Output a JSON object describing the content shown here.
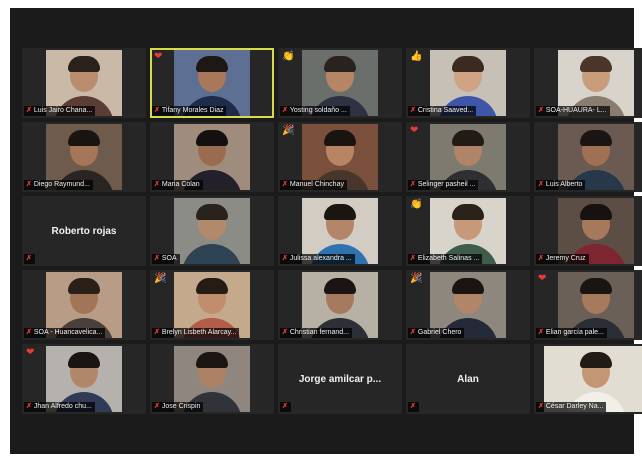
{
  "participants": [
    {
      "name": "Luis Jairo Chana...",
      "reaction": "",
      "active": false,
      "video": true,
      "bg": "#c9b9a6",
      "skin": "#b98c6e",
      "hair": "#2b211c",
      "shirt": "#5b3d35"
    },
    {
      "name": "Tifany Morales Diaz",
      "reaction": "heart",
      "active": true,
      "video": true,
      "bg": "#5d6f93",
      "skin": "#a9775a",
      "hair": "#1e1713",
      "shirt": "#1f2b4b"
    },
    {
      "name": "Yosting soldaño ...",
      "reaction": "clap",
      "active": false,
      "video": true,
      "bg": "#6b6f6b",
      "skin": "#b58566",
      "hair": "#2a231d",
      "shirt": "#2e3140"
    },
    {
      "name": "Cristina Saaved...",
      "reaction": "thumb",
      "active": false,
      "video": true,
      "bg": "#c7c0b6",
      "skin": "#d0a384",
      "hair": "#3a2a20",
      "shirt": "#3d56a8"
    },
    {
      "name": "SOA-HUAURA- L...",
      "reaction": "",
      "active": false,
      "video": true,
      "bg": "#d9d4cb",
      "skin": "#c99c7c",
      "hair": "#4a3528",
      "shirt": "#8a7c6f"
    },
    {
      "name": "Diego Raymund...",
      "reaction": "",
      "active": false,
      "video": true,
      "bg": "#6f5b4c",
      "skin": "#a57657",
      "hair": "#1a1410",
      "shirt": "#2a2523"
    },
    {
      "name": "Maria Colan",
      "reaction": "",
      "active": false,
      "video": true,
      "bg": "#9f8c7c",
      "skin": "#9a6b4e",
      "hair": "#141010",
      "shirt": "#23202a"
    },
    {
      "name": "Manuel Chinchay",
      "reaction": "party",
      "active": false,
      "video": true,
      "bg": "#7a4f3b",
      "skin": "#b88564",
      "hair": "#1a1411",
      "shirt": "#46362c"
    },
    {
      "name": "Selinger pasheil ...",
      "reaction": "heart",
      "active": false,
      "video": true,
      "bg": "#7d7b6f",
      "skin": "#b08468",
      "hair": "#211a15",
      "shirt": "#2f2f33"
    },
    {
      "name": "Luis Alberto",
      "reaction": "",
      "active": false,
      "video": true,
      "bg": "#6a5a51",
      "skin": "#a07055",
      "hair": "#1a1512",
      "shirt": "#263849"
    },
    {
      "name": "Roberto rojas",
      "reaction": "",
      "active": false,
      "video": false
    },
    {
      "name": "SOA",
      "reaction": "",
      "active": false,
      "video": true,
      "bg": "#8c8c86",
      "skin": "#b1896b",
      "hair": "#2a221c",
      "shirt": "#2e4454"
    },
    {
      "name": "Julissa alexandra ...",
      "reaction": "",
      "active": false,
      "video": true,
      "bg": "#d3ccc2",
      "skin": "#b3866a",
      "hair": "#1b1512",
      "shirt": "#2f72b0"
    },
    {
      "name": "Elizabeth Salinas ...",
      "reaction": "clap",
      "active": false,
      "video": true,
      "bg": "#d8d3cb",
      "skin": "#c7997b",
      "hair": "#2b211b",
      "shirt": "#3f5b4b"
    },
    {
      "name": "Jeremy Cruz",
      "reaction": "",
      "active": false,
      "video": true,
      "bg": "#5d4e45",
      "skin": "#a6785c",
      "hair": "#17120f",
      "shirt": "#7e2630"
    },
    {
      "name": "SOA - Huancavelica...",
      "reaction": "",
      "active": false,
      "video": true,
      "bg": "#b89c86",
      "skin": "#a27458",
      "hair": "#2a1f19",
      "shirt": "#4b3f3a"
    },
    {
      "name": "Brelyn Lisbeth Alarcay...",
      "reaction": "party",
      "active": false,
      "video": true,
      "bg": "#c4a98d",
      "skin": "#c08e6f",
      "hair": "#261c16",
      "shirt": "#b35c47"
    },
    {
      "name": "Christian fernand...",
      "reaction": "",
      "active": false,
      "video": true,
      "bg": "#b7b0a5",
      "skin": "#a57a5e",
      "hair": "#1a1512",
      "shirt": "#2d2f36"
    },
    {
      "name": "Gabriel Chero",
      "reaction": "party",
      "active": false,
      "video": true,
      "bg": "#8e877e",
      "skin": "#b08568",
      "hair": "#1b1511",
      "shirt": "#252a38"
    },
    {
      "name": "Elian garcía pale...",
      "reaction": "heart",
      "active": false,
      "video": true,
      "bg": "#6b6058",
      "skin": "#a77a5d",
      "hair": "#1a1512",
      "shirt": "#2a2d33"
    },
    {
      "name": "Jhan Alfredo chu...",
      "reaction": "heart",
      "active": false,
      "video": true,
      "bg": "#b5b2ad",
      "skin": "#b18769",
      "hair": "#1a1512",
      "shirt": "#2f3b57"
    },
    {
      "name": "Jose Crispin",
      "reaction": "",
      "active": false,
      "video": true,
      "bg": "#8f877f",
      "skin": "#ad8264",
      "hair": "#1b1612",
      "shirt": "#303338"
    },
    {
      "name": "Jorge amilcar p...",
      "reaction": "",
      "active": false,
      "video": false
    },
    {
      "name": "Alan",
      "reaction": "",
      "active": false,
      "video": false
    },
    {
      "name": "César Darley Na...",
      "reaction": "",
      "active": false,
      "video": true,
      "bg": "#e2ddd2",
      "skin": "#c39676",
      "hair": "#221a15",
      "shirt": "#f1efe8"
    }
  ],
  "icons": {
    "mic_muted": "✗",
    "heart": "❤",
    "clap": "👏",
    "thumb": "👍",
    "party": "🎉"
  }
}
